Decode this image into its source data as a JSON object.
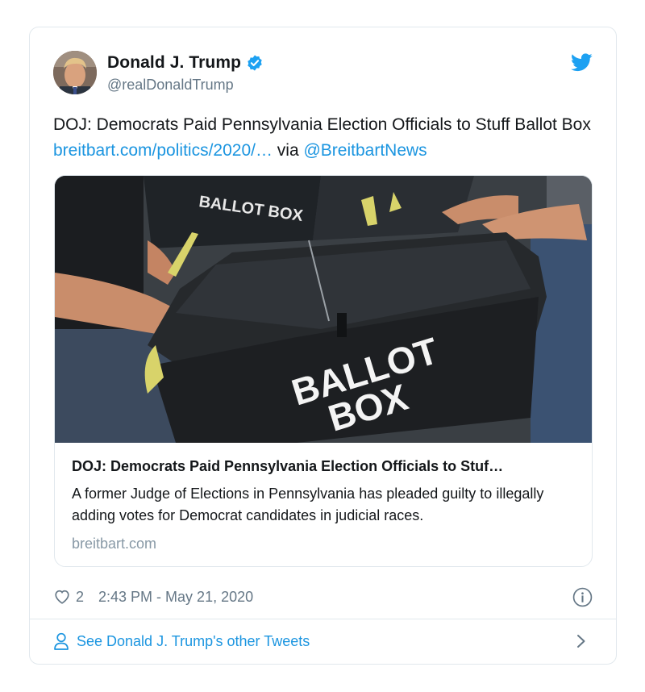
{
  "author": {
    "display_name": "Donald J. Trump",
    "handle": "@realDonaldTrump",
    "verified": true
  },
  "tweet": {
    "text_before_link": "DOJ: Democrats Paid Pennsylvania Election Officials to Stuff Ballot Box ",
    "link_text": "breitbart.com/politics/2020/…",
    "via_text": " via ",
    "mention": "@BreitbartNews"
  },
  "card": {
    "image_text_top": "BALLOT BOX",
    "image_text_main_line1": "BALLOT",
    "image_text_main_line2": "BOX",
    "title": "DOJ: Democrats Paid Pennsylvania Election Officials to Stuf…",
    "description": "A former Judge of Elections in Pennsylvania has pleaded guilty to illegally adding votes for Democrat candidates in judicial races.",
    "domain": "breitbart.com"
  },
  "meta": {
    "like_count": "2",
    "timestamp": "2:43 PM - May 21, 2020"
  },
  "footer": {
    "see_more_label": "See Donald J. Trump's other Tweets"
  },
  "icons": {
    "verified": "verified-badge-icon",
    "brand": "twitter-bird-icon",
    "like": "heart-icon",
    "info": "info-icon",
    "profile": "person-icon",
    "more": "chevron-right-icon"
  },
  "colors": {
    "link": "#1b95e0",
    "brand": "#1da1f2",
    "secondary_text": "#657786",
    "border": "#e1e8ed"
  }
}
